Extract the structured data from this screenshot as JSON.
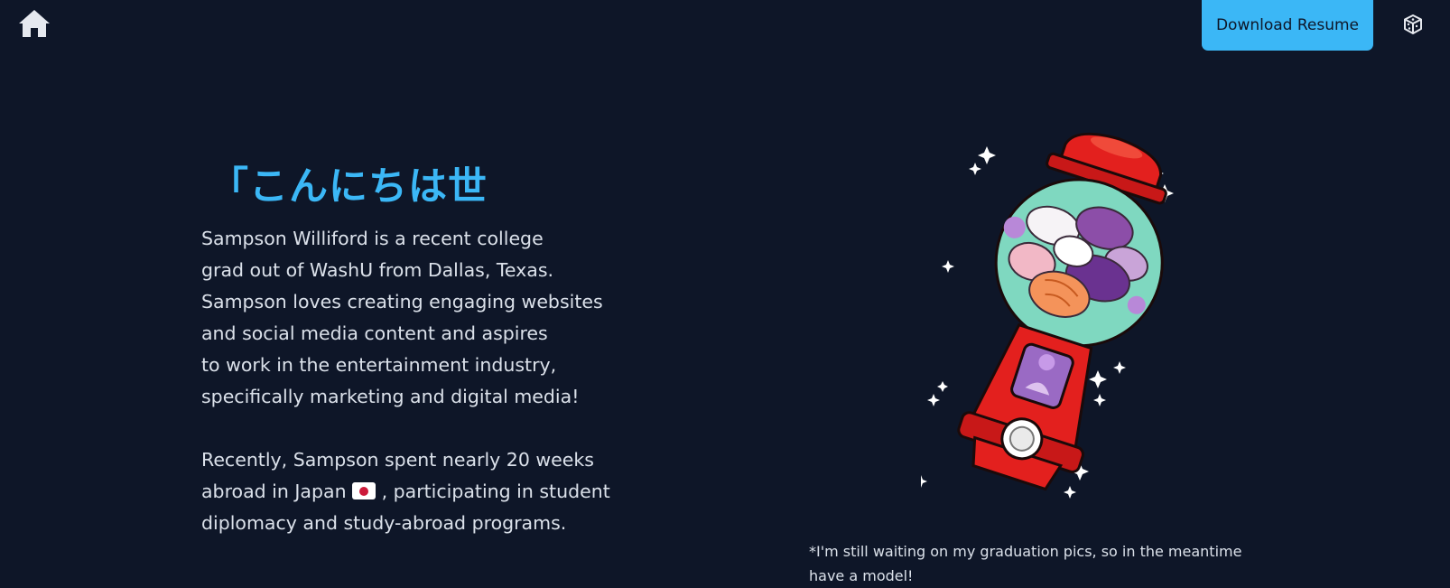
{
  "nav": {
    "home_icon": "home-icon",
    "resume_label": "Download Resume",
    "dice_icon": "dice-icon"
  },
  "hero": {
    "greeting": "「こんにちは世",
    "bio_paragraph_1": [
      "Sampson Williford is a recent college",
      "grad out of WashU from Dallas, Texas.",
      "Sampson loves creating engaging websites",
      "and social media content and aspires",
      "to work in the entertainment industry,",
      "specifically marketing and digital media!"
    ],
    "bio_paragraph_2": {
      "line1": "Recently, Sampson spent nearly 20 weeks",
      "line2_before_flag": "abroad in Japan ",
      "line2_after_flag": " , participating in student",
      "line3": "diplomacy and study-abroad programs."
    },
    "flag_icon": "japan-flag-icon"
  },
  "illustration": {
    "name": "gumball-machine-with-cats",
    "caption": "*I'm still waiting on my graduation pics, so in the meantime have a model!"
  },
  "colors": {
    "background": "#0e1628",
    "accent": "#3bb7f6",
    "text": "#dbe1ea",
    "machine_red": "#e3201e",
    "globe_teal": "#7fd8c0"
  }
}
